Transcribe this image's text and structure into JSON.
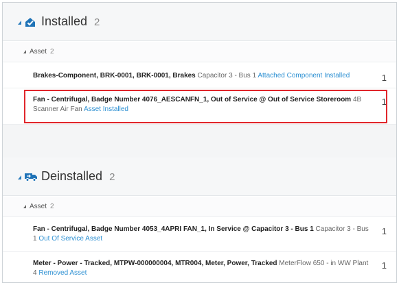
{
  "installed": {
    "title": "Installed",
    "count": "2",
    "group": {
      "label": "Asset",
      "count": "2"
    },
    "items": [
      {
        "name": "Brakes-Component, BRK-0001, BRK-0001, Brakes",
        "location": " Capacitor 3 - Bus 1 ",
        "status": "Attached Component Installed",
        "count": "1"
      },
      {
        "name": "Fan - Centrifugal, Badge Number 4076_AESCANFN_1, Out of Service @ Out of Service Storeroom",
        "location": " 4B Scanner Air Fan ",
        "status": "Asset Installed",
        "count": "1"
      }
    ]
  },
  "deinstalled": {
    "title": "Deinstalled",
    "count": "2",
    "group": {
      "label": "Asset",
      "count": "2"
    },
    "items": [
      {
        "name": "Fan - Centrifugal, Badge Number 4053_4APRI FAN_1, In Service @ Capacitor 3 - Bus 1",
        "location": " Capacitor 3 - Bus 1 ",
        "status": "Out Of Service Asset",
        "count": "1"
      },
      {
        "name": "Meter - Power - Tracked, MTPW-000000004, MTR004, Meter, Power, Tracked",
        "location": " MeterFlow 650 - in WW Plant 4 ",
        "status": "Removed Asset",
        "count": "1"
      }
    ]
  },
  "colors": {
    "accent": "#2b8fd2",
    "highlight": "#e0262b",
    "header_bg": "#f6f7f8"
  },
  "icons": {
    "installed": "house-check-icon",
    "deinstalled": "truck-icon"
  }
}
